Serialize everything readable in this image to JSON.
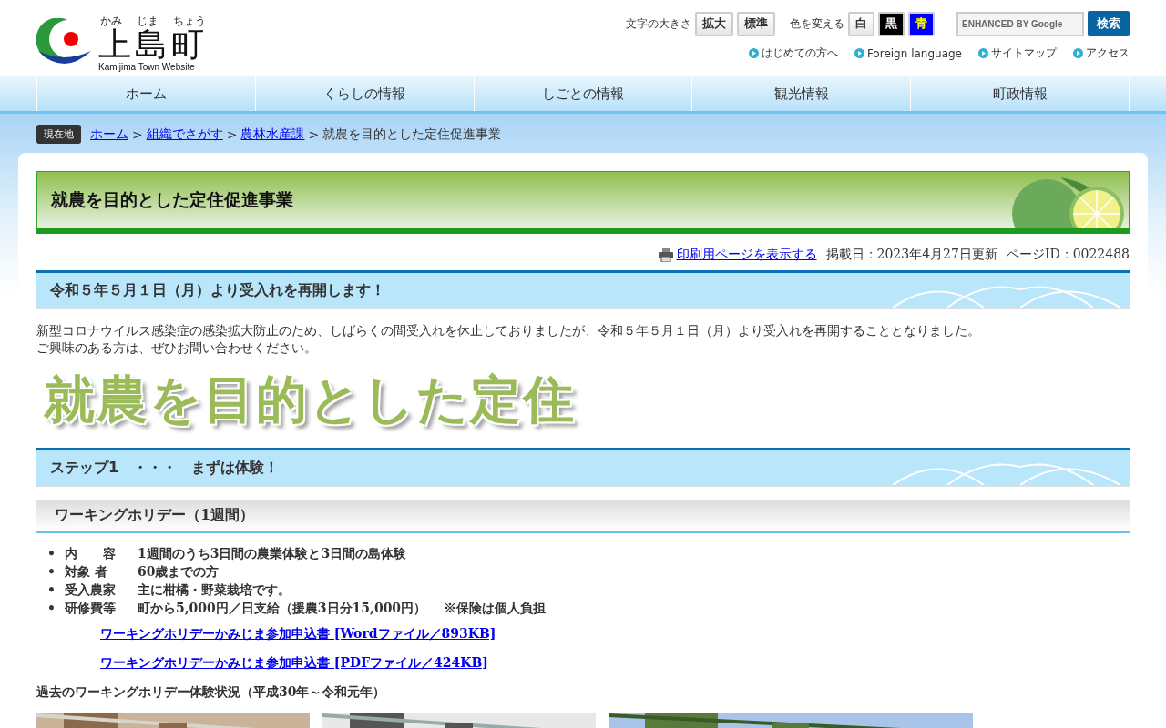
{
  "header": {
    "logo": {
      "ruby": [
        "かみ",
        "じま",
        "ちょう"
      ],
      "name": "上島町",
      "subtitle": "Kamijima Town Website"
    },
    "font_size": {
      "label": "文字の大きさ",
      "buttons": [
        "拡大",
        "標準"
      ]
    },
    "color_change": {
      "label": "色を変える",
      "buttons": [
        {
          "label": "白",
          "kind": "white"
        },
        {
          "label": "黒",
          "kind": "black"
        },
        {
          "label": "青",
          "kind": "blue"
        }
      ]
    },
    "search": {
      "placeholder": "ENHANCED BY Google",
      "button": "検索"
    },
    "utility_links": [
      "はじめての方へ",
      "Foreign language",
      "サイトマップ",
      "アクセス"
    ]
  },
  "nav": [
    "ホーム",
    "くらしの情報",
    "しごとの情報",
    "観光情報",
    "町政情報"
  ],
  "breadcrumb": {
    "badge": "現在地",
    "separator": ">",
    "items": [
      {
        "label": "ホーム",
        "kind": "link"
      },
      {
        "label": "組織でさがす",
        "kind": "link"
      },
      {
        "label": "農林水産課",
        "kind": "link"
      },
      {
        "label": "就農を目的とした定住促進事業",
        "kind": "current"
      }
    ]
  },
  "page_title": "就農を目的とした定住促進事業",
  "meta": {
    "print_link": "印刷用ページを表示する",
    "posted": "掲載日：2023年4月27日更新",
    "page_id": "ページID：0022488"
  },
  "blocks": [
    {
      "kind": "h2",
      "text": "令和５年５月１日（月）より受入れを再開します！"
    },
    {
      "kind": "paragraph",
      "lines": [
        "新型コロナウイルス感染症の感染拡大防止のため、しばらくの間受入れを休止しておりましたが、令和５年５月１日（月）より受入れを再開することとなりました。",
        "ご興味のある方は、ぜひお問い合わせください。"
      ]
    },
    {
      "kind": "banner",
      "text": "就農を目的とした定住"
    },
    {
      "kind": "h2",
      "text": "ステップ1　・・・　まずは体験！"
    },
    {
      "kind": "h3",
      "text": "ワーキングホリデー（1週間）"
    },
    {
      "kind": "bullets",
      "marker": "•",
      "items": [
        {
          "term": "内　　容",
          "value": "1週間のうち3日間の農業体験と3日間の島体験"
        },
        {
          "term": "対象 者",
          "value": "60歳までの方"
        },
        {
          "term": "受入農家",
          "value": "主に柑橘・野菜栽培です。"
        },
        {
          "term": "研修費等",
          "value": "町から5,000円／日支給（援農3日分15,000円）　 ※保険は個人負担"
        }
      ]
    },
    {
      "kind": "link",
      "text": "ワーキングホリデーかみじま参加申込書 [Wordファイル／893KB]"
    },
    {
      "kind": "link",
      "text": "ワーキングホリデーかみじま参加申込書 [PDFファイル／424KB]"
    },
    {
      "kind": "caption",
      "text": "過去のワーキングホリデー体験状況（平成30年～令和元年）"
    },
    {
      "kind": "photos"
    }
  ]
}
